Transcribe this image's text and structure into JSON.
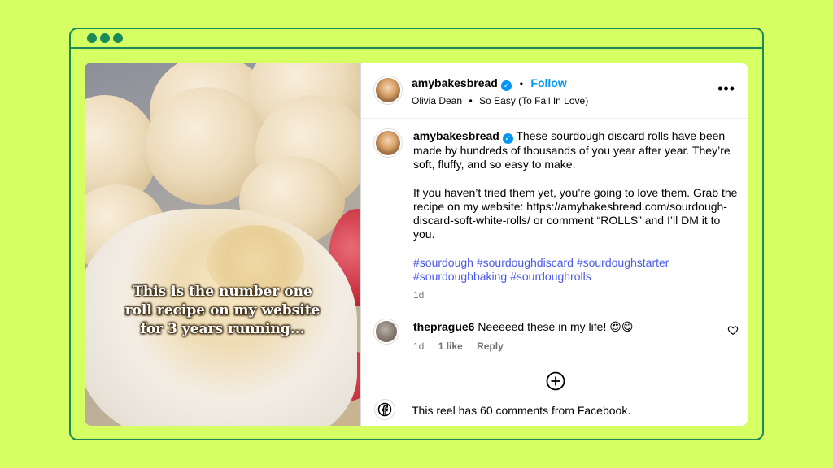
{
  "header": {
    "username": "amybakesbread",
    "follow_label": "Follow",
    "separator": "•",
    "audio_artist": "Olivia Dean",
    "audio_track": "So Easy (To Fall In Love)"
  },
  "media": {
    "overlay_lines": [
      "This is the number one",
      "roll recipe on my website",
      "for 3 years running..."
    ]
  },
  "caption": {
    "username": "amybakesbread",
    "paragraph1": "These sourdough discard rolls have been made by hundreds of thousands of you year after year. They’re soft, fluffy, and so easy to make.",
    "paragraph2": "If you haven’t tried them yet, you’re going to love them. Grab the recipe on my website: https://amybakesbread.com/sourdough-discard-soft-white-rolls/ or comment “ROLLS” and I’ll DM it to you.",
    "hashtags": "#sourdough #sourdoughdiscard #sourdoughstarter #sourdoughbaking #sourdoughrolls",
    "time": "1d"
  },
  "comment": {
    "username": "theprague6",
    "text": "Neeeeed these in my life! 😍😋",
    "time": "1d",
    "likes": "1 like",
    "reply_label": "Reply"
  },
  "footer": {
    "facebook_text": "This reel has 60 comments from Facebook."
  },
  "colors": {
    "background": "#d6ff63",
    "frame": "#1a8a5a",
    "link_blue": "#0095f6",
    "hashtag": "#4a5ae8"
  }
}
